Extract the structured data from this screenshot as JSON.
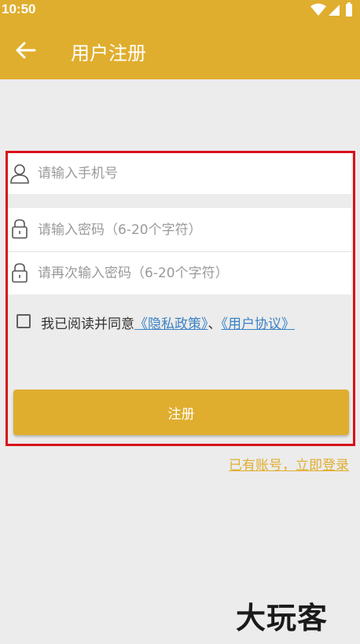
{
  "status_bar": {
    "time": "10:50"
  },
  "header": {
    "title": "用户注册"
  },
  "form": {
    "phone_placeholder": "请输入手机号",
    "password_placeholder": "请输入密码（6-20个字符）",
    "confirm_password_placeholder": "请再次输入密码（6-20个字符）",
    "agree_prefix": "我已阅读并同意",
    "privacy_link": "《隐私政策》",
    "separator": "、",
    "terms_link": "《用户协议》",
    "submit_label": "注册",
    "login_link": "已有账号，立即登录"
  },
  "watermark": "大玩客",
  "colors": {
    "accent": "#e0ae2e",
    "link": "#3b82c4",
    "highlight": "#d9101a",
    "background": "#ececec"
  },
  "icons": {
    "back": "arrow-left-icon",
    "phone": "user-icon",
    "password": "lock-icon"
  }
}
